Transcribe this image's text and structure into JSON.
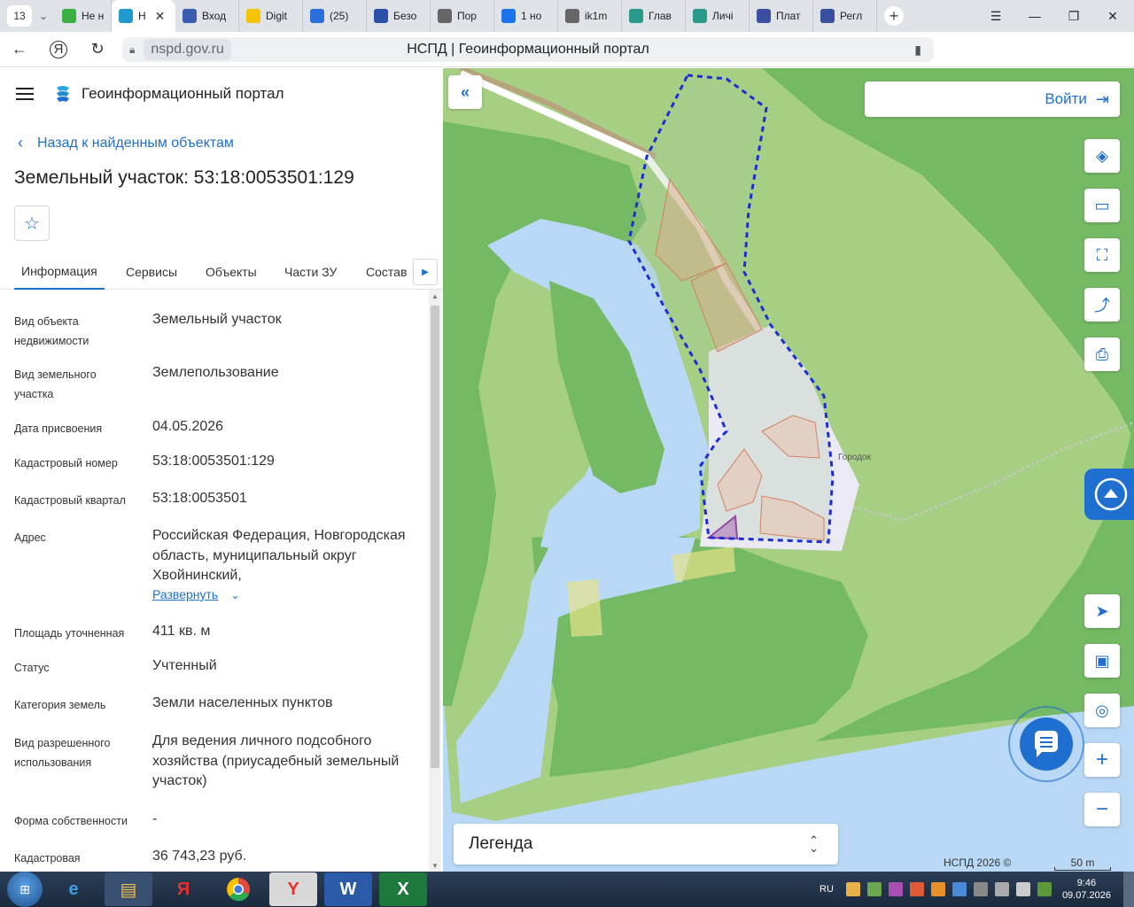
{
  "browser": {
    "tab_count": "13",
    "tabs": [
      {
        "label": "Не н",
        "icon": "check-icon",
        "color": "#3cb043"
      },
      {
        "label": "Н",
        "icon": "nspd-icon",
        "color": "#1f9ad1",
        "active": true
      },
      {
        "label": "Вход",
        "icon": "gosuslugi-icon",
        "color": "#3a5db0"
      },
      {
        "label": "Digit",
        "icon": "folder-icon",
        "color": "#f5c400"
      },
      {
        "label": "(25)",
        "icon": "mail-icon",
        "color": "#2a6fdb"
      },
      {
        "label": "Безо",
        "icon": "at-icon",
        "color": "#2a4fa8"
      },
      {
        "label": "Пор",
        "icon": "document-icon",
        "color": "#666666"
      },
      {
        "label": "1 но",
        "icon": "one-icon",
        "color": "#1a73e8"
      },
      {
        "label": "ik1m",
        "icon": "document-icon",
        "color": "#666666"
      },
      {
        "label": "Глав",
        "icon": "emblem-icon",
        "color": "#2b9a8a"
      },
      {
        "label": "Личі",
        "icon": "emblem-icon",
        "color": "#2b9a8a"
      },
      {
        "label": "Плат",
        "icon": "eagle-icon",
        "color": "#3a4fa0"
      },
      {
        "label": "Регл",
        "icon": "eagle-icon",
        "color": "#3a4fa0"
      }
    ],
    "url_host": "nspd.gov.ru",
    "page_title": "НСПД | Геоинформационный портал"
  },
  "portal": {
    "title": "Геоинформационный портал",
    "back_label": "Назад к найденным объектам",
    "object_title": "Земельный участок: 53:18:0053501:129",
    "tabs": [
      "Информация",
      "Сервисы",
      "Объекты",
      "Части ЗУ",
      "Состав"
    ],
    "properties": [
      {
        "label": "Вид объекта недвижимости",
        "value": "Земельный участок"
      },
      {
        "label": "Вид земельного участка",
        "value": "Землепользование"
      },
      {
        "label": "Дата присвоения",
        "value": "04.05.2026"
      },
      {
        "label": "Кадастровый номер",
        "value": "53:18:0053501:129"
      },
      {
        "label": "Кадастровый квартал",
        "value": "53:18:0053501"
      },
      {
        "label": "Адрес",
        "value": "Российская Федерация, Новгородская область, муниципальный округ Хвойнинский,"
      },
      {
        "label": "Площадь уточненная",
        "value": "411 кв. м"
      },
      {
        "label": "Статус",
        "value": "Учтенный"
      },
      {
        "label": "Категория земель",
        "value": "Земли населенных пунктов"
      },
      {
        "label": "Вид разрешенного использования",
        "value": "Для ведения личного подсобного хозяйства (приусадебный земельный участок)"
      },
      {
        "label": "Форма собственности",
        "value": "-"
      },
      {
        "label": "Кадастровая",
        "value": "36 743,23 руб."
      }
    ],
    "expand_label": "Развернуть"
  },
  "map": {
    "login_label": "Войти",
    "legend_label": "Легенда",
    "copyright": "НСПД 2026 ©",
    "scale_label": "50 m",
    "place_label": "Городок",
    "accent": "#1f6fd1"
  },
  "taskbar": {
    "lang": "RU",
    "time": "9:46",
    "date": "09.07.2026"
  }
}
